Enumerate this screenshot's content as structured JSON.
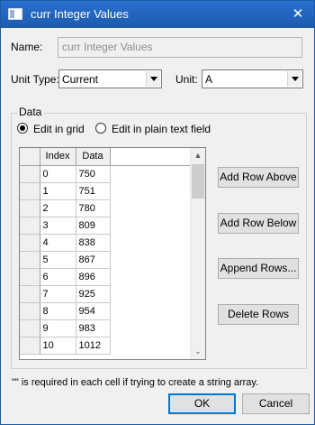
{
  "window": {
    "title": "curr Integer Values",
    "close_glyph": "✕"
  },
  "name_field": {
    "label": "Name:",
    "placeholder": "curr Integer Values"
  },
  "unit_type": {
    "label": "Unit Type:",
    "value": "Current"
  },
  "unit": {
    "label": "Unit:",
    "value": "A"
  },
  "data_group": {
    "legend": "Data",
    "radio_grid_label": "Edit in grid",
    "radio_text_label": "Edit in plain text field",
    "selected": "grid"
  },
  "grid": {
    "columns": [
      "Index",
      "Data"
    ],
    "rows": [
      {
        "index": "0",
        "data": "750"
      },
      {
        "index": "1",
        "data": "751"
      },
      {
        "index": "2",
        "data": "780"
      },
      {
        "index": "3",
        "data": "809"
      },
      {
        "index": "4",
        "data": "838"
      },
      {
        "index": "5",
        "data": "867"
      },
      {
        "index": "6",
        "data": "896"
      },
      {
        "index": "7",
        "data": "925"
      },
      {
        "index": "8",
        "data": "954"
      },
      {
        "index": "9",
        "data": "983"
      },
      {
        "index": "10",
        "data": "1012"
      }
    ],
    "scroll_up_glyph": "▲",
    "scroll_down_glyph": "⌄"
  },
  "buttons": {
    "add_row_above": "Add Row Above",
    "add_row_below": "Add Row Below",
    "append_rows": "Append Rows...",
    "delete_rows": "Delete Rows",
    "ok": "OK",
    "cancel": "Cancel"
  },
  "note": "\"\" is required in each cell if trying to create a string array.",
  "colors": {
    "titlebar": "#1c5cae",
    "dialog_bg": "#f0f0f0",
    "default_button_border": "#0078d7"
  }
}
